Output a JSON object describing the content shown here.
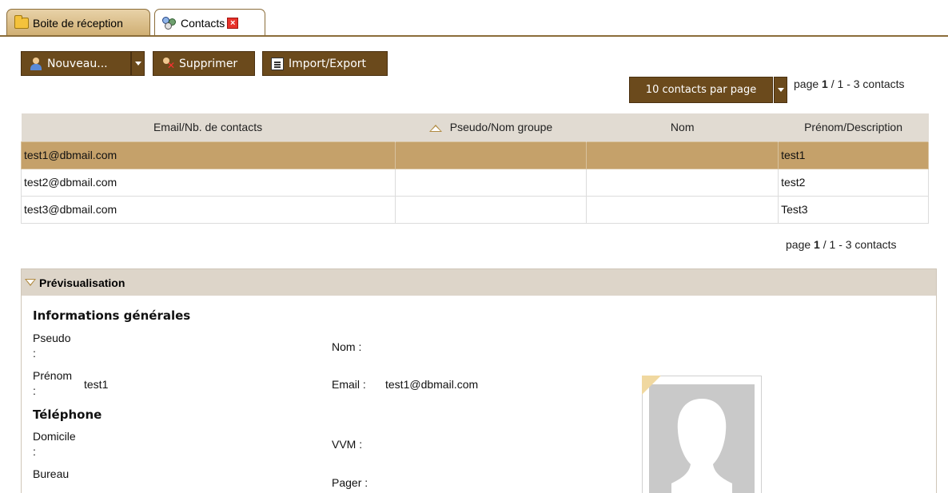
{
  "tabs": [
    {
      "label": "Boite de réception",
      "icon": "folder-icon"
    },
    {
      "label": "Contacts",
      "icon": "contacts-icon"
    }
  ],
  "toolbar": {
    "new_label": "Nouveau...",
    "delete_label": "Supprimer",
    "import_export_label": "Import/Export"
  },
  "pager": {
    "per_page": "10 contacts par page",
    "page_prefix": "page ",
    "page_current": "1",
    "page_suffix": " / 1 - 3 contacts"
  },
  "table": {
    "headers": [
      "Email/Nb. de contacts",
      "Pseudo/Nom groupe",
      "Nom",
      "Prénom/Description"
    ],
    "rows": [
      [
        "test1@dbmail.com",
        "",
        "",
        "test1"
      ],
      [
        "test2@dbmail.com",
        "",
        "",
        "test2"
      ],
      [
        "test3@dbmail.com",
        "",
        "",
        "Test3"
      ]
    ]
  },
  "preview": {
    "title": "Prévisualisation",
    "general_heading": "Informations générales",
    "pseudo_label": "Pseudo",
    "colon": ":",
    "nom_label": "Nom :",
    "prenom_label": "Prénom",
    "prenom_value": "test1",
    "email_label": "Email :",
    "email_value": "test1@dbmail.com",
    "phone_heading": "Téléphone",
    "domicile_label": "Domicile",
    "vvm_label": "VVM :",
    "bureau_label": "Bureau",
    "pager_label": "Pager :"
  },
  "colors": {
    "accent": "#6b4a1c",
    "selected_row": "#c5a16a",
    "header_bg": "#e1dbd2"
  }
}
